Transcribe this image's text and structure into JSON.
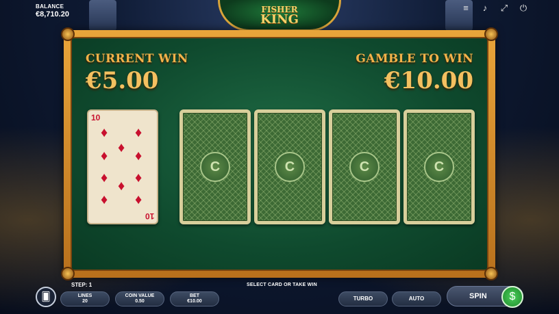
{
  "header": {
    "balance_label": "BALANCE",
    "balance_value": "€8,710.20",
    "logo_line1": "FISHER",
    "logo_line2": "KING"
  },
  "gamble": {
    "current_win_label": "CURRENT WIN",
    "current_win_value": "€5.00",
    "gamble_to_win_label": "GAMBLE TO WIN",
    "gamble_to_win_value": "€10.00",
    "revealed_card": {
      "rank": "10",
      "suit": "diamonds",
      "suit_symbol": "♦"
    },
    "hidden_cards": [
      {
        "emblem": "fish-hook-emblem"
      },
      {
        "emblem": "fish-hook-emblem"
      },
      {
        "emblem": "fish-hook-emblem"
      },
      {
        "emblem": "fish-hook-emblem"
      }
    ]
  },
  "footer": {
    "step": "STEP: 1",
    "instruction": "SELECT CARD OR TAKE WIN",
    "lines_label": "LINES",
    "lines_value": "20",
    "coin_value_label": "COIN VALUE",
    "coin_value_value": "0.50",
    "bet_label": "BET",
    "bet_value": "€10.00",
    "turbo_label": "TURBO",
    "auto_label": "AUTO",
    "spin_label": "SPIN"
  },
  "colors": {
    "gold": "#f4c060",
    "felt": "#1f6a44",
    "card_red": "#c8102e"
  }
}
